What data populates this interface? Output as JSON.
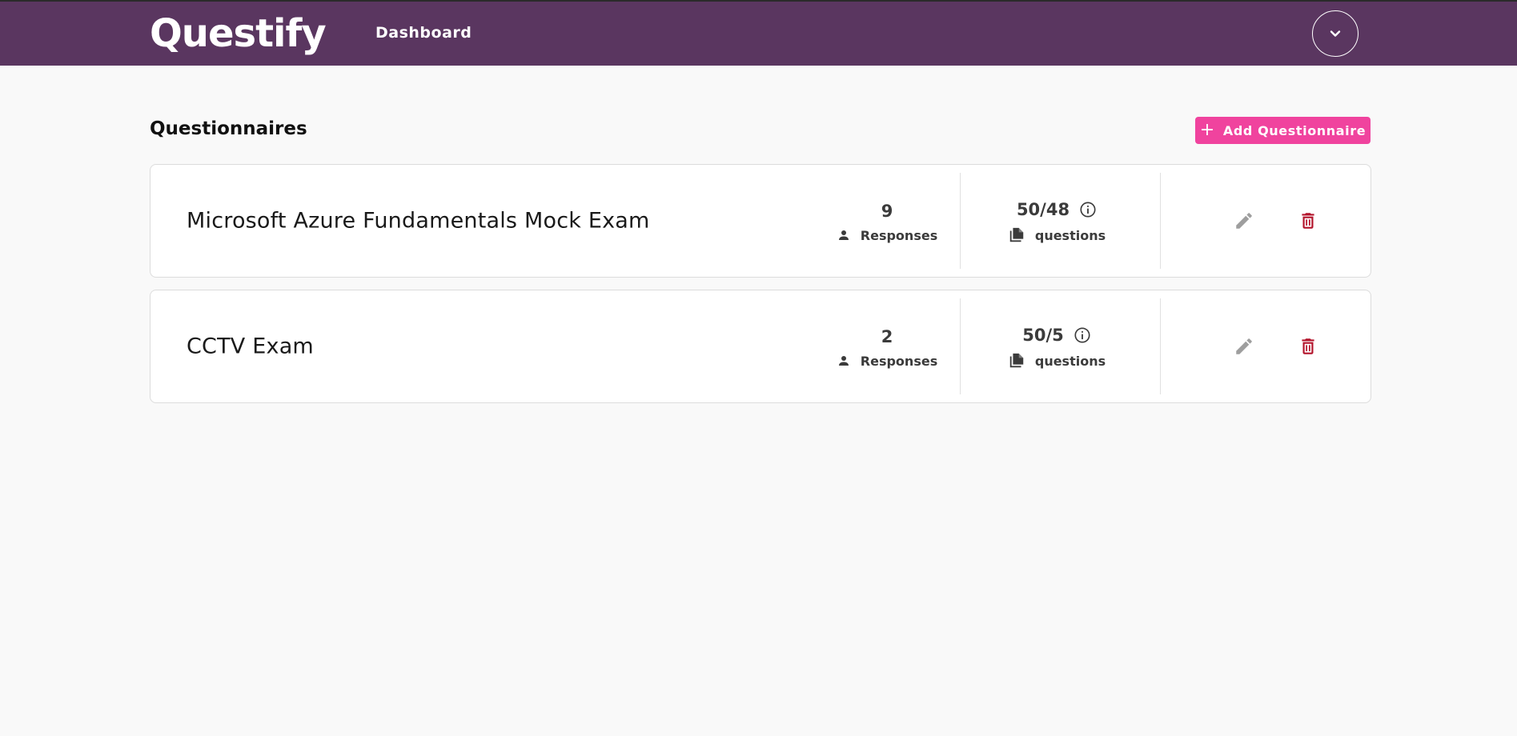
{
  "app": {
    "brand": "Questify",
    "nav": {
      "dashboard": "Dashboard"
    }
  },
  "page": {
    "title": "Questionnaires",
    "add_button": "Add Questionnaire"
  },
  "questionnaires": [
    {
      "title": "Microsoft Azure Fundamentals Mock Exam",
      "responses_count": "9",
      "responses_label": "Responses",
      "questions_count": "50/48",
      "questions_label": "questions"
    },
    {
      "title": "CCTV Exam",
      "responses_count": "2",
      "responses_label": "Responses",
      "questions_count": "50/5",
      "questions_label": "questions"
    }
  ],
  "icons": {
    "account_dropdown": "chevron-down-icon",
    "add": "plus-icon",
    "responses": "person-icon",
    "questions": "documents-icon",
    "info": "info-icon",
    "edit": "pencil-icon",
    "delete": "trash-icon"
  },
  "colors": {
    "navbar": "#5a3660",
    "accent": "#f0439e",
    "delete": "#b3142b",
    "edit": "#9e9e9e"
  }
}
